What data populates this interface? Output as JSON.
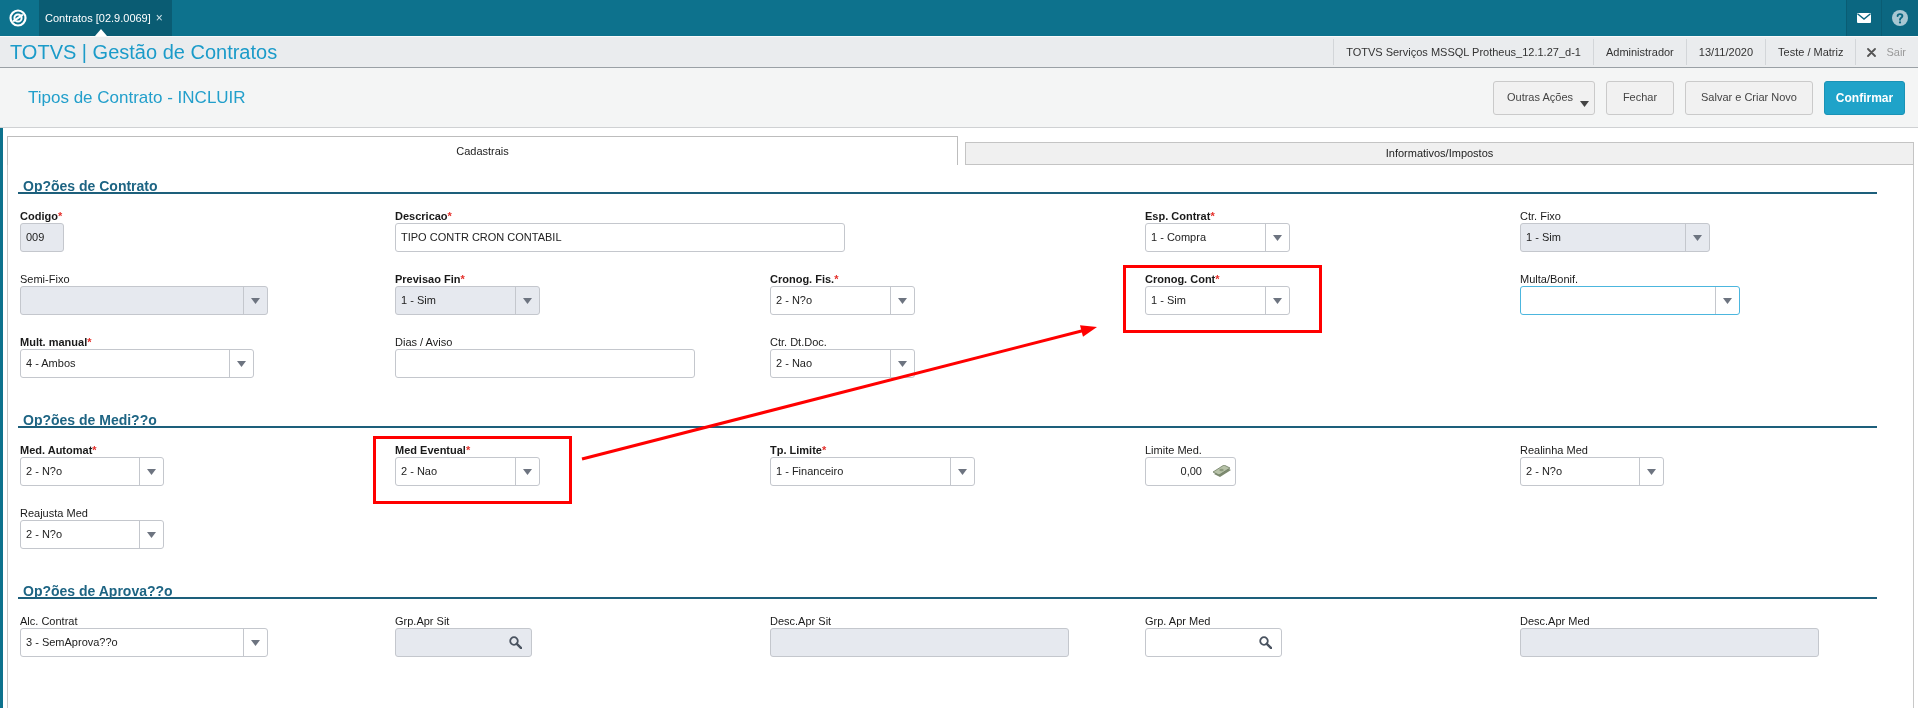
{
  "top_bar": {
    "tabs": [
      {
        "label": "Contratos [02.9.0069]",
        "close": "×",
        "selected": true
      }
    ]
  },
  "header": {
    "app_title": "TOTVS | Gestão de Contratos",
    "info": [
      "TOTVS Serviços MSSQL Protheus_12.1.27_d-1",
      "Administrador",
      "13/11/2020",
      "Teste / Matriz"
    ],
    "logout": "Sair"
  },
  "page": {
    "title": "Tipos de Contrato - INCLUIR",
    "buttons": [
      {
        "label": "Outras Ações",
        "kind": "menu"
      },
      {
        "label": "Fechar",
        "kind": "default"
      },
      {
        "label": "Salvar e Criar Novo",
        "kind": "default"
      },
      {
        "label": "Confirmar",
        "kind": "primary"
      }
    ]
  },
  "tabs": [
    {
      "label": "Cadastrais",
      "selected": true
    },
    {
      "label": "Informativos/Impostos",
      "selected": false
    }
  ],
  "sections": [
    {
      "title": "Op?ões de Contrato",
      "fields": [
        {
          "label": "Codigo",
          "required_mark": "*",
          "kind": "text",
          "value": "009",
          "disabled": true,
          "focused": false,
          "highlighted": false
        },
        {
          "label": "Descricao",
          "required_mark": "*",
          "kind": "text",
          "value": "TIPO CONTR CRON CONTABIL",
          "disabled": false,
          "focused": false,
          "highlighted": false
        },
        {
          "label": "Esp. Contrat",
          "required_mark": "*",
          "kind": "select",
          "value": "1 - Compra",
          "disabled": false,
          "focused": false,
          "highlighted": false
        },
        {
          "label": "Ctr. Fixo",
          "kind": "select",
          "value": "1 - Sim",
          "disabled": true,
          "focused": false,
          "highlighted": false
        },
        {
          "label": "Semi-Fixo",
          "kind": "select",
          "disabled": true,
          "focused": false,
          "highlighted": false
        },
        {
          "label": "Previsao Fin",
          "required_mark": "*",
          "kind": "select",
          "value": "1 - Sim",
          "disabled": true,
          "focused": false,
          "highlighted": false
        },
        {
          "label": "Cronog. Fis.",
          "required_mark": "*",
          "kind": "select",
          "value": "2 - N?o",
          "disabled": false,
          "focused": false,
          "highlighted": false
        },
        {
          "label": "Cronog. Cont",
          "required_mark": "*",
          "kind": "select",
          "value": "1 - Sim",
          "disabled": false,
          "focused": false,
          "highlighted": true
        },
        {
          "label": "Multa/Bonif.",
          "kind": "select",
          "disabled": false,
          "focused": true,
          "highlighted": false
        },
        {
          "label": "Mult. manual",
          "required_mark": "*",
          "kind": "select",
          "value": "4 - Ambos",
          "disabled": false,
          "focused": false,
          "highlighted": false
        },
        {
          "label": "Dias / Aviso",
          "kind": "text",
          "disabled": false,
          "focused": false,
          "highlighted": false
        },
        {
          "label": "Ctr. Dt.Doc.",
          "kind": "select",
          "value": "2 - Nao",
          "disabled": false,
          "focused": false,
          "highlighted": false
        }
      ]
    },
    {
      "title": "Op?ões de Medi??o",
      "fields": [
        {
          "label": "Med. Automat",
          "required_mark": "*",
          "kind": "select",
          "value": "2 - N?o",
          "disabled": false,
          "focused": false,
          "highlighted": false
        },
        {
          "label": "Med Eventual",
          "required_mark": "*",
          "kind": "select",
          "value": "2 - Nao",
          "disabled": false,
          "focused": false,
          "highlighted": true
        },
        {
          "label": "Tp. Limite",
          "required_mark": "*",
          "kind": "select",
          "value": "1 - Financeiro",
          "disabled": false,
          "focused": false,
          "highlighted": false
        },
        {
          "label": "Limite Med.",
          "kind": "currency",
          "value": "0,00",
          "disabled": false,
          "focused": false,
          "highlighted": false
        },
        {
          "label": "Realinha Med",
          "kind": "select",
          "value": "2 - N?o",
          "disabled": false,
          "focused": false,
          "highlighted": false
        },
        {
          "label": "Reajusta Med",
          "kind": "select",
          "value": "2 - N?o",
          "disabled": false,
          "focused": false,
          "highlighted": false
        }
      ]
    },
    {
      "title": "Op?ões de Aprova??o",
      "fields": [
        {
          "label": "Alc. Contrat",
          "kind": "select",
          "value": "3 - SemAprova??o",
          "disabled": false,
          "focused": false,
          "highlighted": false
        },
        {
          "label": "Grp.Apr Sit",
          "kind": "lookup",
          "disabled": true,
          "focused": false,
          "highlighted": false
        },
        {
          "label": "Desc.Apr Sit",
          "kind": "text",
          "disabled": true,
          "focused": false,
          "highlighted": false
        },
        {
          "label": "Grp. Apr Med",
          "kind": "lookup",
          "disabled": false,
          "focused": false,
          "highlighted": false
        },
        {
          "label": "Desc.Apr Med",
          "kind": "text",
          "disabled": true,
          "focused": false,
          "highlighted": false
        }
      ]
    }
  ]
}
